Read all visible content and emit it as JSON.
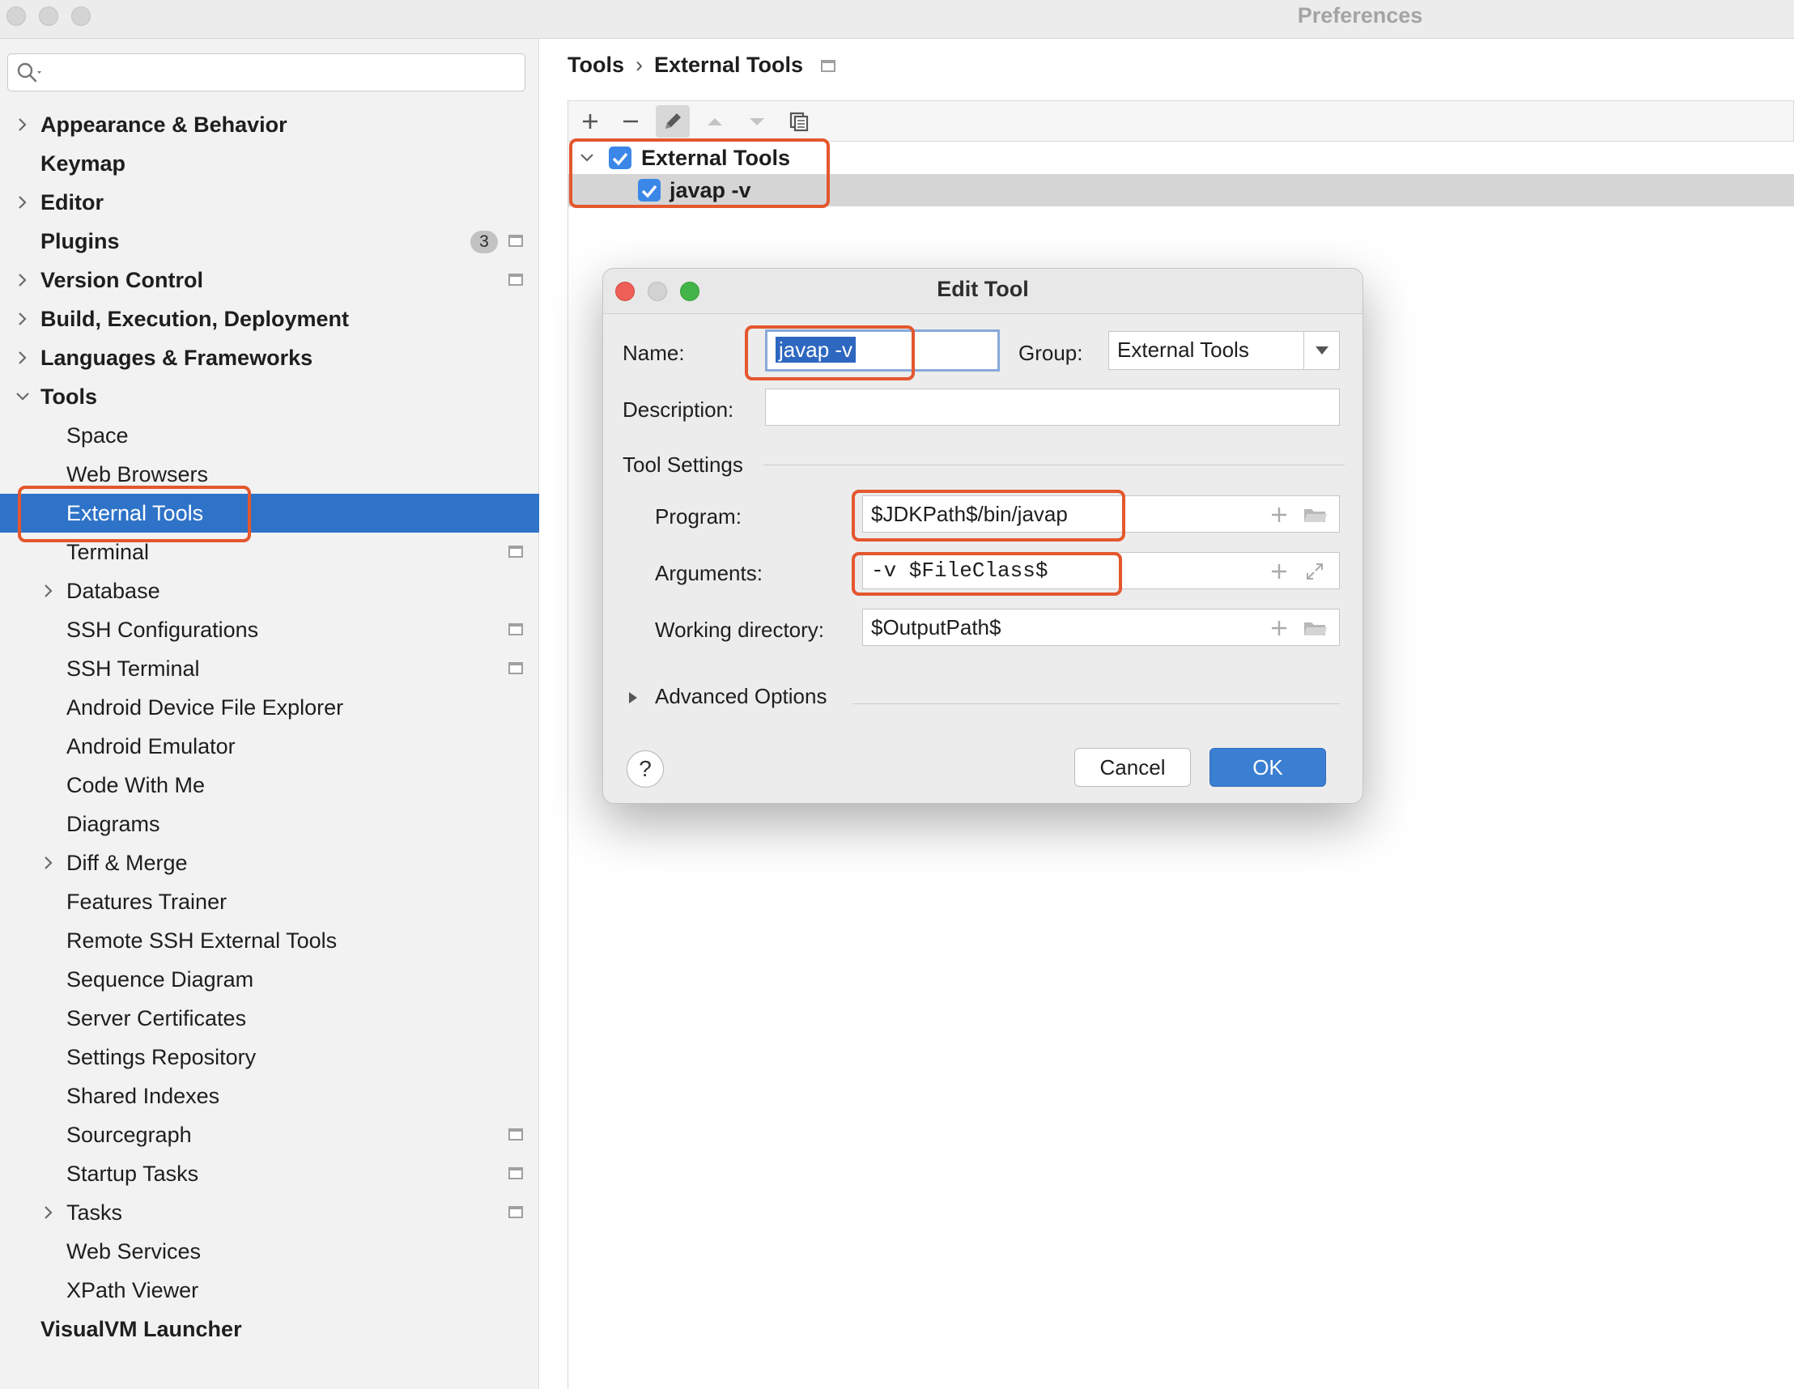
{
  "window": {
    "title": "Preferences"
  },
  "search": {
    "placeholder": "",
    "value": ""
  },
  "sidebar": {
    "items": [
      {
        "label": "Appearance & Behavior",
        "bold": true,
        "chevron": "right",
        "level": 0
      },
      {
        "label": "Keymap",
        "bold": true,
        "chevron": "",
        "level": 0
      },
      {
        "label": "Editor",
        "bold": true,
        "chevron": "right",
        "level": 0
      },
      {
        "label": "Plugins",
        "bold": true,
        "chevron": "",
        "level": 0,
        "badge": "3",
        "project_icon": true
      },
      {
        "label": "Version Control",
        "bold": true,
        "chevron": "right",
        "level": 0,
        "project_icon": true
      },
      {
        "label": "Build, Execution, Deployment",
        "bold": true,
        "chevron": "right",
        "level": 0
      },
      {
        "label": "Languages & Frameworks",
        "bold": true,
        "chevron": "right",
        "level": 0
      },
      {
        "label": "Tools",
        "bold": true,
        "chevron": "down",
        "level": 0
      },
      {
        "label": "Space",
        "level": 1
      },
      {
        "label": "Web Browsers",
        "level": 1
      },
      {
        "label": "External Tools",
        "level": 1,
        "selected": true
      },
      {
        "label": "Terminal",
        "level": 1,
        "project_icon": true
      },
      {
        "label": "Database",
        "level": 1,
        "chevron": "right"
      },
      {
        "label": "SSH Configurations",
        "level": 1,
        "project_icon": true
      },
      {
        "label": "SSH Terminal",
        "level": 1,
        "project_icon": true
      },
      {
        "label": "Android Device File Explorer",
        "level": 1
      },
      {
        "label": "Android Emulator",
        "level": 1
      },
      {
        "label": "Code With Me",
        "level": 1
      },
      {
        "label": "Diagrams",
        "level": 1
      },
      {
        "label": "Diff & Merge",
        "level": 1,
        "chevron": "right"
      },
      {
        "label": "Features Trainer",
        "level": 1
      },
      {
        "label": "Remote SSH External Tools",
        "level": 1
      },
      {
        "label": "Sequence Diagram",
        "level": 1
      },
      {
        "label": "Server Certificates",
        "level": 1
      },
      {
        "label": "Settings Repository",
        "level": 1
      },
      {
        "label": "Shared Indexes",
        "level": 1
      },
      {
        "label": "Sourcegraph",
        "level": 1,
        "project_icon": true
      },
      {
        "label": "Startup Tasks",
        "level": 1,
        "project_icon": true
      },
      {
        "label": "Tasks",
        "level": 1,
        "chevron": "right",
        "project_icon": true
      },
      {
        "label": "Web Services",
        "level": 1
      },
      {
        "label": "XPath Viewer",
        "level": 1
      },
      {
        "label": "VisualVM Launcher",
        "bold": true,
        "level": 0
      }
    ]
  },
  "breadcrumb": {
    "parent": "Tools",
    "separator": "›",
    "current": "External Tools"
  },
  "toolbar": {
    "buttons": [
      {
        "icon": "plus-icon"
      },
      {
        "icon": "minus-icon"
      },
      {
        "icon": "edit-icon",
        "active": true
      },
      {
        "icon": "move-up-icon",
        "disabled": true
      },
      {
        "icon": "move-down-icon",
        "disabled": true
      },
      {
        "icon": "copy-icon"
      }
    ]
  },
  "tree": {
    "group": {
      "label": "External Tools",
      "checked": true,
      "expanded": true
    },
    "tool": {
      "label": "javap -v",
      "checked": true
    }
  },
  "dialog": {
    "title": "Edit Tool",
    "name_label": "Name:",
    "name_value": "javap -v",
    "group_label": "Group:",
    "group_value": "External Tools",
    "description_label": "Description:",
    "description_value": "",
    "tool_settings_label": "Tool Settings",
    "program_label": "Program:",
    "program_value": "$JDKPath$/bin/javap",
    "arguments_label": "Arguments:",
    "arguments_value": "-v $FileClass$",
    "workdir_label": "Working directory:",
    "workdir_value": "$OutputPath$",
    "advanced_label": "Advanced Options",
    "help_label": "?",
    "cancel_label": "Cancel",
    "ok_label": "OK"
  },
  "colors": {
    "selection": "#2f73c8",
    "annotation": "#e4572e",
    "checkbox": "#3b87e8",
    "ok_button": "#3b7fd2",
    "close_dot": "#ed5f57",
    "max_dot": "#43b548"
  }
}
